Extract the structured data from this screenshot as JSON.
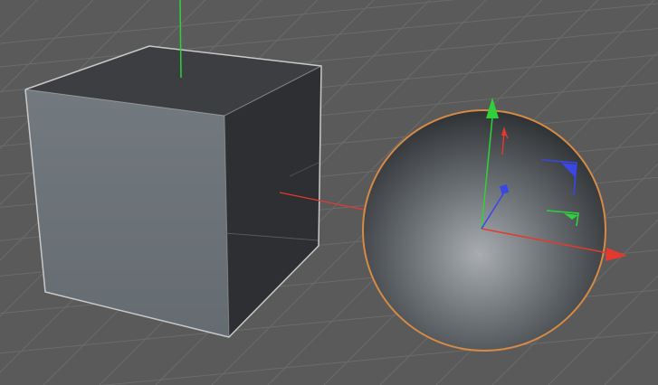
{
  "viewport": {
    "background_color": "#5a5a5a",
    "grid_color": "#6b6b6b"
  },
  "objects": {
    "cube": {
      "type": "cube",
      "selected": false,
      "top_face_color": "#3c3e41",
      "front_face_color": "#6e757c",
      "side_face_color": "#2d2f32",
      "outline_color": "#c9c9c9"
    },
    "sphere": {
      "type": "sphere",
      "selected": true,
      "highlight_color": "#a9adb1",
      "shadow_color": "#2b2e31",
      "selection_outline_color": "#d58a45"
    }
  },
  "axes": {
    "x_color": "#e23a2f",
    "y_color": "#2fd13a",
    "z_color": "#3a46e8"
  },
  "icons": {
    "move_y_handle": "arrow-up-icon",
    "move_x_handle": "arrow-right-icon",
    "move_z_handle": "axis-z-handle-icon",
    "rotate_xy_plane": "plane-handle-icon",
    "rotate_yz_plane": "plane-handle-icon",
    "rotate_xz_plane": "plane-handle-icon"
  }
}
